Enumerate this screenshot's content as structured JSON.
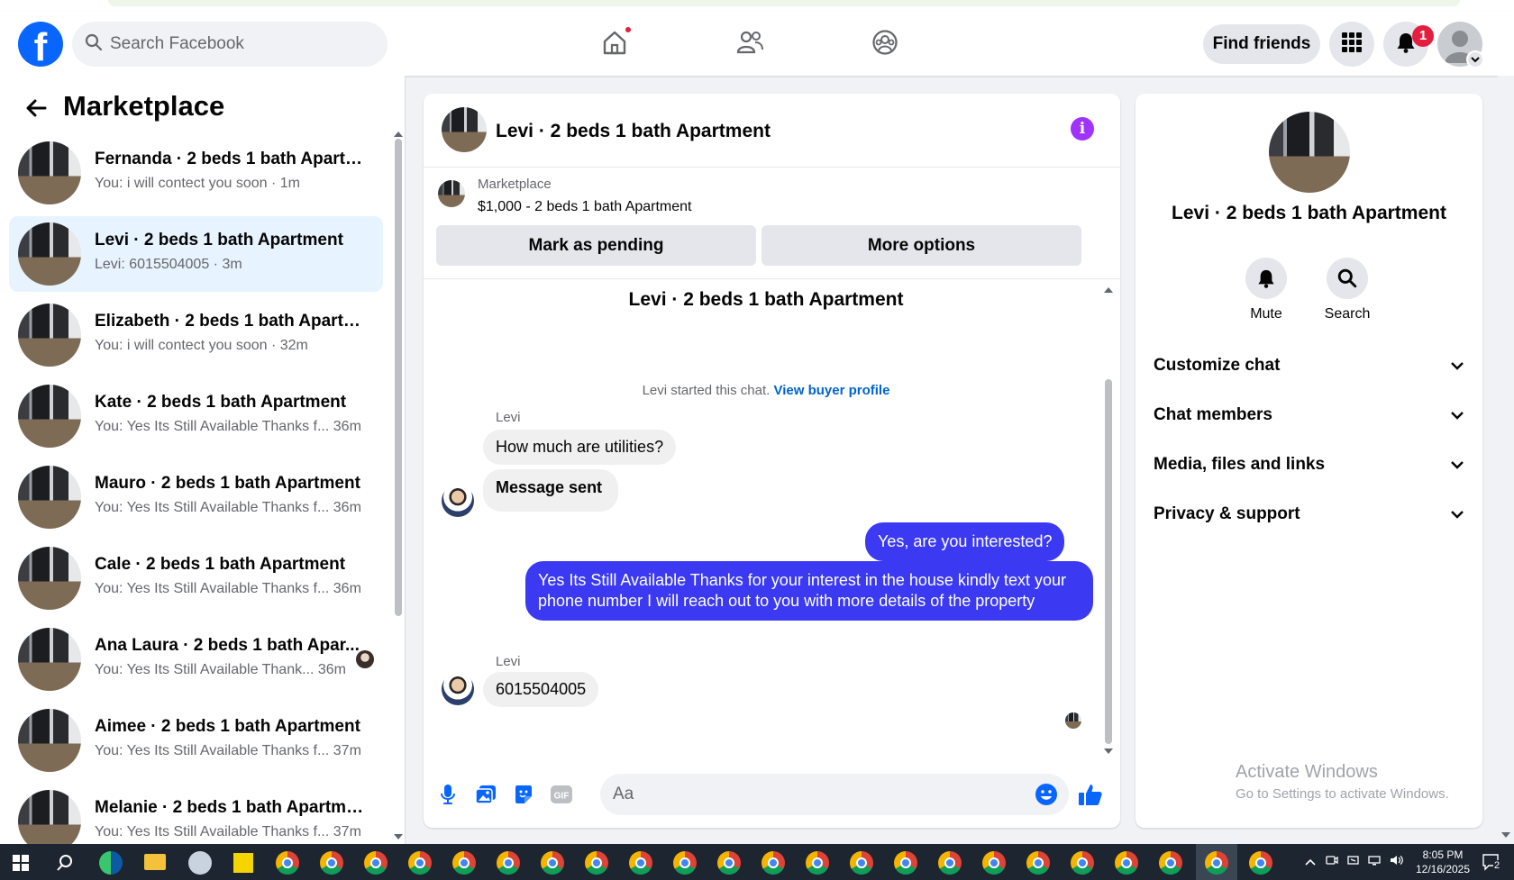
{
  "header": {
    "search_placeholder": "Search Facebook",
    "find_friends_label": "Find friends",
    "notification_count": "1",
    "brand_color": "#0866ff"
  },
  "sidebar": {
    "title": "Marketplace",
    "conversations": [
      {
        "name": "Fernanda · 2 beds 1 bath Apartm...",
        "preview": "You: i will contect you soon · 1m"
      },
      {
        "name": "Levi · 2 beds 1 bath Apartment",
        "preview": "Levi: 6015504005 · 3m",
        "active": true
      },
      {
        "name": "Elizabeth · 2 beds 1 bath Apartm...",
        "preview": "You: i will contect you soon · 32m"
      },
      {
        "name": "Kate · 2 beds 1 bath Apartment",
        "preview": "You: Yes Its Still Available Thanks f...  36m"
      },
      {
        "name": "Mauro · 2 beds 1 bath Apartment",
        "preview": "You: Yes Its Still Available Thanks f...  36m"
      },
      {
        "name": "Cale · 2 beds 1 bath Apartment",
        "preview": "You: Yes Its Still Available Thanks f...  36m"
      },
      {
        "name": "Ana Laura · 2 beds 1 bath Apar...",
        "preview": "You: Yes Its Still Available Thank...  36m"
      },
      {
        "name": "Aimee · 2 beds 1 bath Apartment",
        "preview": "You: Yes Its Still Available Thanks f...  37m"
      },
      {
        "name": "Melanie · 2 beds 1 bath Apartment",
        "preview": "You: Yes Its Still Available Thanks f...  37m"
      }
    ]
  },
  "chat": {
    "title": "Levi · 2 beds 1 bath Apartment",
    "listing_label": "Marketplace",
    "listing_price": "$1,000 - 2 beds 1 bath Apartment",
    "mark_pending_label": "Mark as pending",
    "more_options_label": "More options",
    "thread_title": "Levi · 2 beds 1 bath Apartment",
    "started_text": "Levi started this chat.",
    "view_profile_label": "View buyer profile",
    "messages": [
      {
        "sender": "Levi",
        "text": "How much are utilities?"
      },
      {
        "text": "Message sent"
      },
      {
        "text": "Yes, are you interested?"
      },
      {
        "text": "Yes Its Still Available Thanks for your interest in the house kindly text your phone number I will reach out to you with more details of the property"
      },
      {
        "sender": "Levi",
        "text": "6015504005"
      }
    ],
    "composer_placeholder": "Aa",
    "outgoing_color": "#3b39f2"
  },
  "info_panel": {
    "name": "Levi · 2 beds 1 bath Apartment",
    "mute_label": "Mute",
    "search_label": "Search",
    "sections": [
      "Customize chat",
      "Chat members",
      "Media, files and links",
      "Privacy & support"
    ],
    "watermark_title": "Activate Windows",
    "watermark_sub": "Go to Settings to activate Windows."
  },
  "taskbar": {
    "time": "8:05 PM",
    "date": "12/16/2025",
    "notif_count": "2"
  }
}
